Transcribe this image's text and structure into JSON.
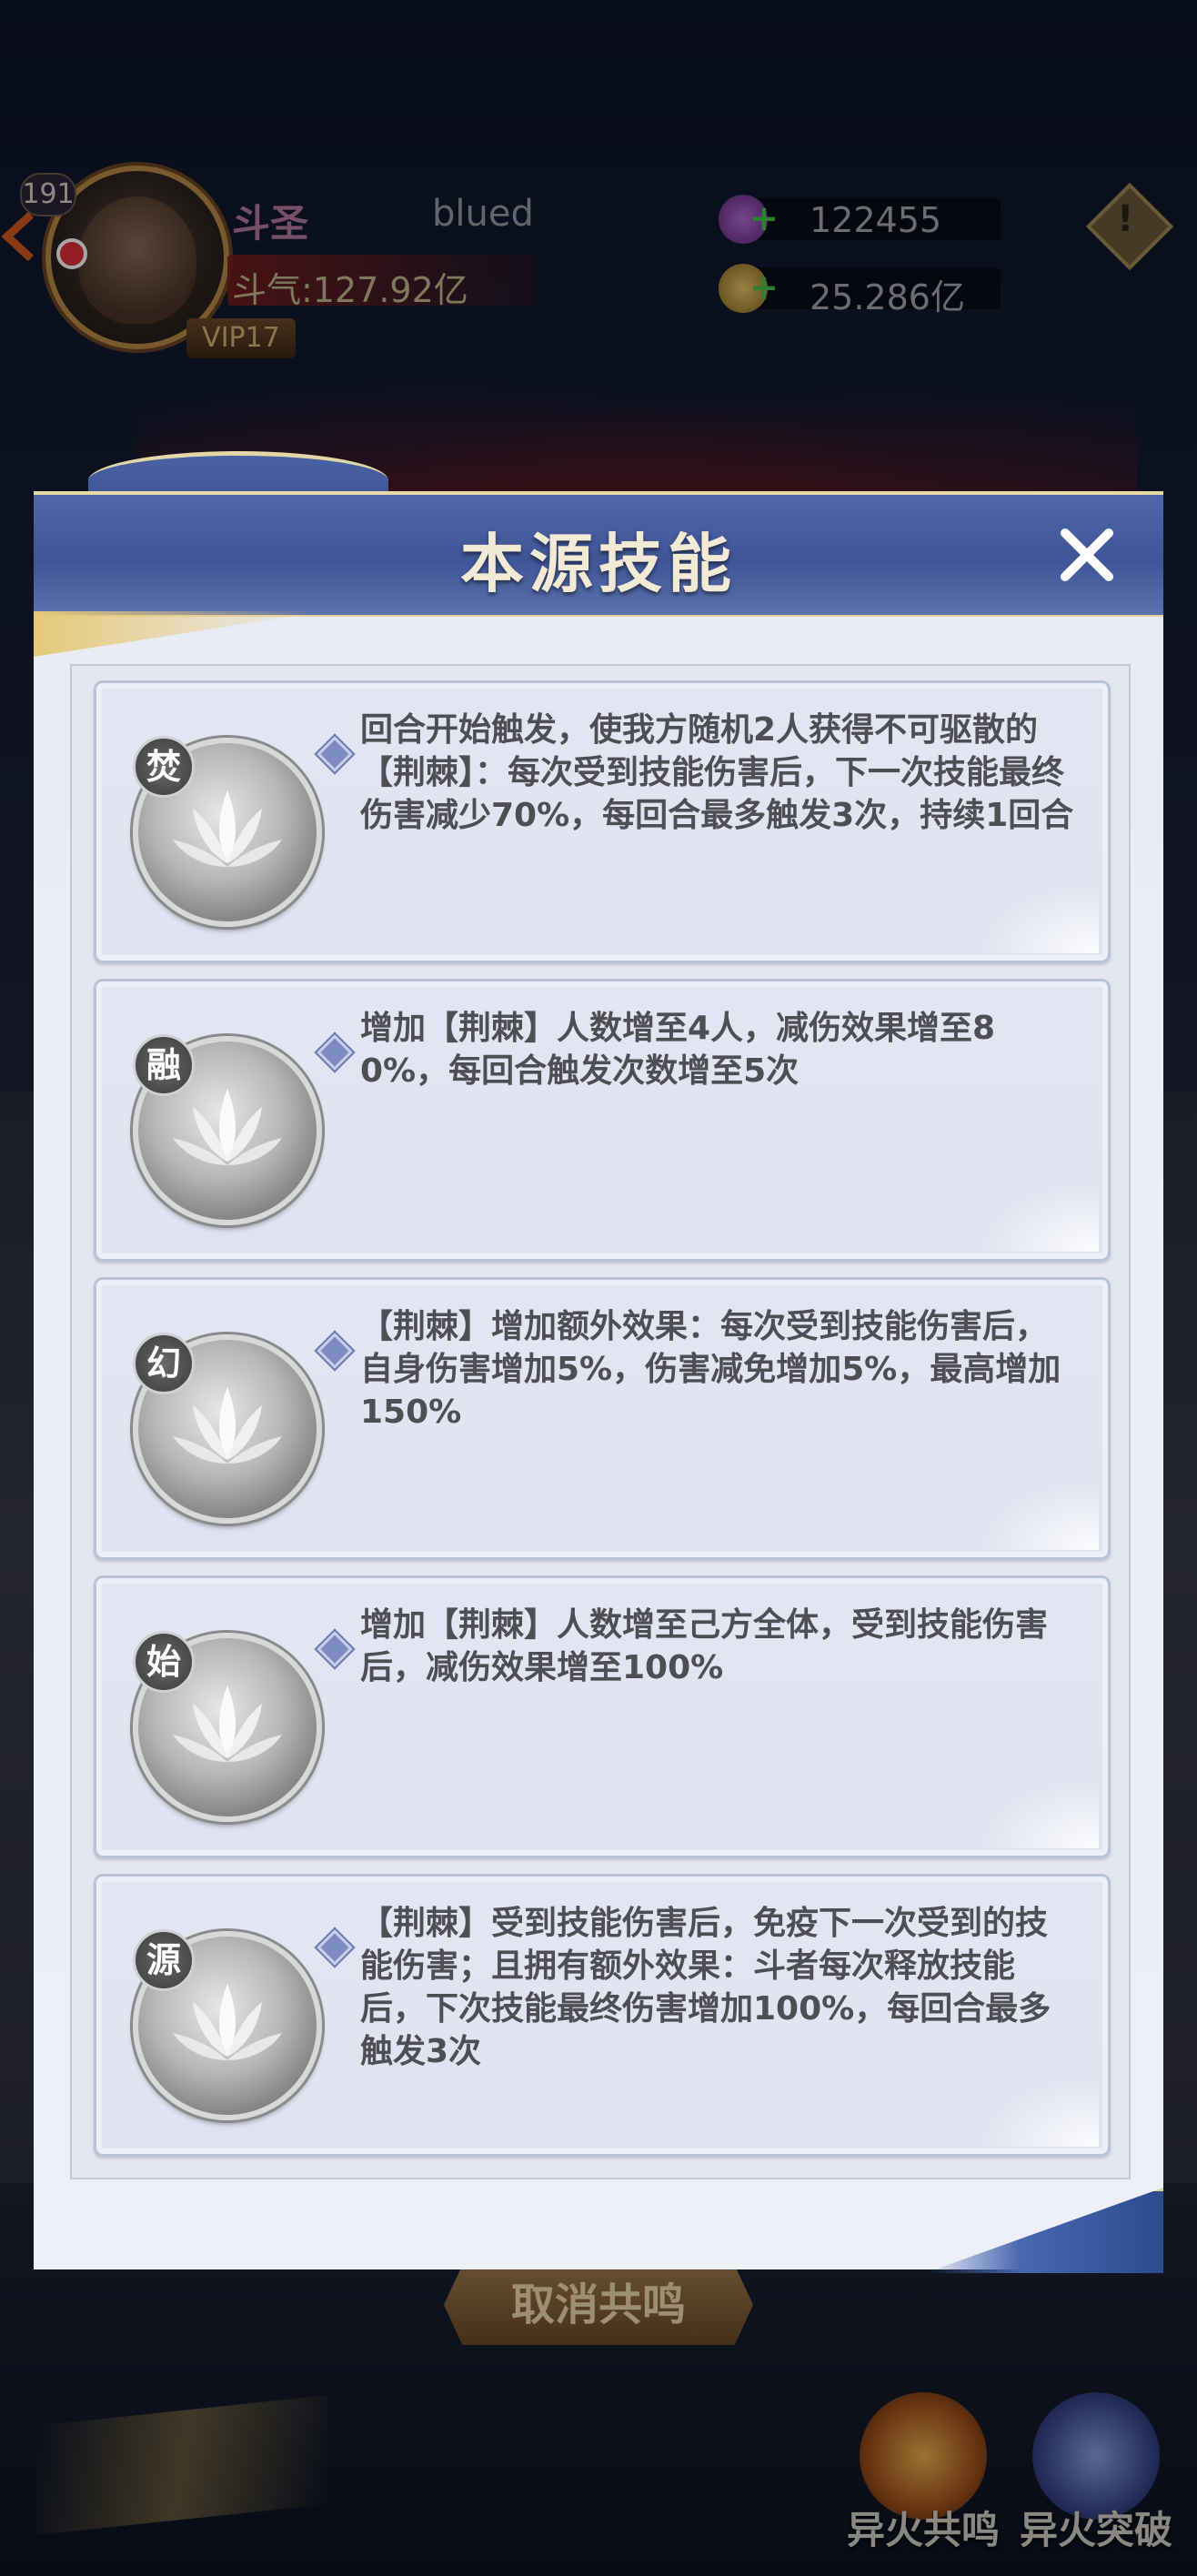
{
  "hud": {
    "level": "191",
    "title": "斗圣",
    "player_name": "blued",
    "power": "斗气:127.92亿",
    "vip": "VIP17",
    "resources": [
      {
        "icon": "purple-crystal-icon",
        "value": "122455"
      },
      {
        "icon": "gold-coin-icon",
        "value": "25.286亿"
      }
    ]
  },
  "modal": {
    "title": "本源技能",
    "skills": [
      {
        "tag": "焚",
        "description": "回合开始触发，使我方随机2人获得不可驱散的【荆棘】：每次受到技能伤害后，下一次技能最终伤害减少70%，每回合最多触发3次，持续1回合"
      },
      {
        "tag": "融",
        "description": "增加【荆棘】人数增至4人，减伤效果增至80%，每回合触发次数增至5次"
      },
      {
        "tag": "幻",
        "description": "【荆棘】增加额外效果：每次受到技能伤害后，自身伤害增加5%，伤害减免增加5%，最高增加150%"
      },
      {
        "tag": "始",
        "description": "增加【荆棘】人数增至己方全体，受到技能伤害后，减伤效果增至100%"
      },
      {
        "tag": "源",
        "description": "【荆棘】受到技能伤害后，免疫下一次受到的技能伤害；且拥有额外效果：斗者每次释放技能后，下次技能最终伤害增加100%，每回合最多触发3次"
      }
    ]
  },
  "background": {
    "cancel_button": "取消共鸣",
    "bottom_buttons": [
      {
        "label": "异火共鸣",
        "icon": "fire-resonance-icon"
      },
      {
        "label": "异火突破",
        "icon": "fire-breakthrough-icon"
      }
    ]
  }
}
